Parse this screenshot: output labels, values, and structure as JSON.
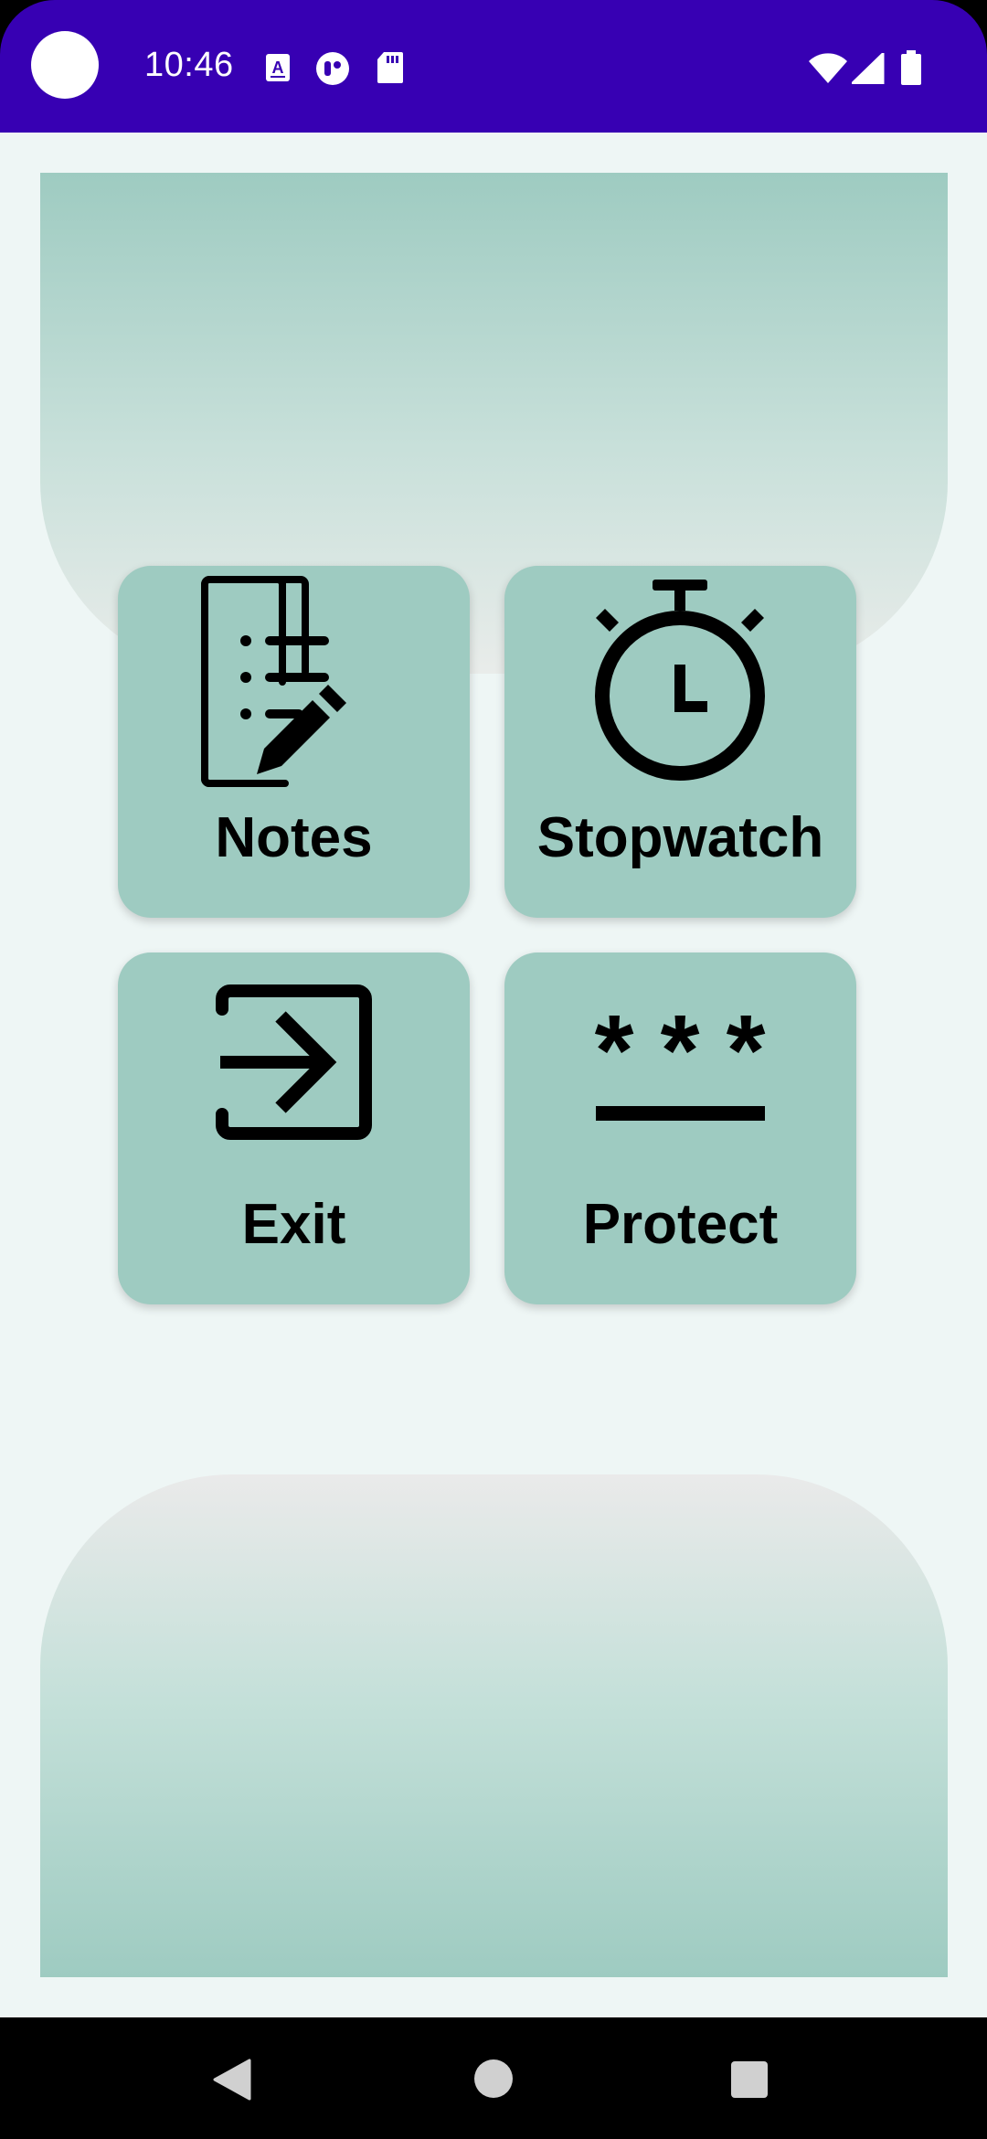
{
  "status_bar": {
    "time": "10:46",
    "color": "#3700b3",
    "left_icons": [
      "camera-cutout-icon",
      "accessibility-a-icon",
      "media-control-icon",
      "sd-card-icon"
    ],
    "right_icons": [
      "wifi-icon",
      "cell-signal-icon",
      "battery-icon"
    ]
  },
  "tiles": [
    {
      "label": "Notes",
      "icon": "notes-icon"
    },
    {
      "label": "Stopwatch",
      "icon": "stopwatch-icon"
    },
    {
      "label": "Exit",
      "icon": "exit-icon"
    },
    {
      "label": "Protect",
      "icon": "password-icon"
    }
  ],
  "colors": {
    "tile": "#9ecbc1",
    "background": "#eef6f5",
    "status_bar": "#3700b3"
  },
  "nav_bar": {
    "buttons": [
      "back-icon",
      "home-icon",
      "recents-icon"
    ]
  }
}
